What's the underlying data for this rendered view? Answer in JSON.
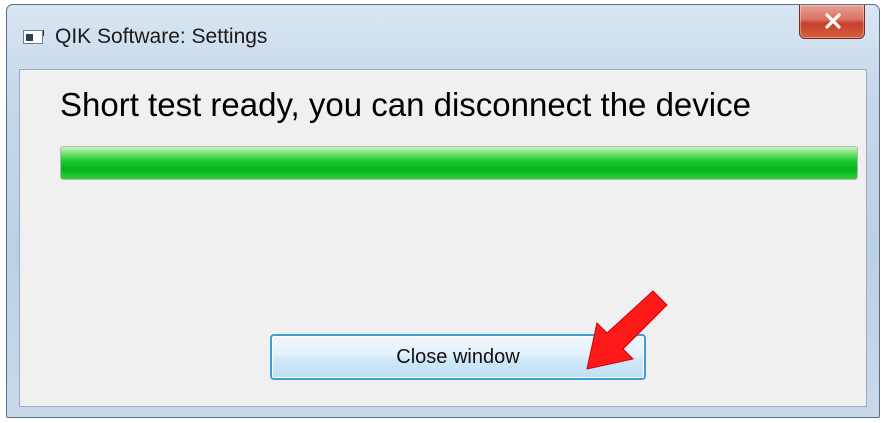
{
  "window": {
    "title": "QIK Software: Settings",
    "title_icon": "app-window-icon",
    "close_icon": "close-icon"
  },
  "content": {
    "message": "Short test ready, you can disconnect the device",
    "progress_percent": 100,
    "progress_color": "#17c92a",
    "close_button_label": "Close window"
  },
  "annotation": {
    "arrow_icon": "red-arrow-icon",
    "arrow_color": "#ff1a1a"
  }
}
